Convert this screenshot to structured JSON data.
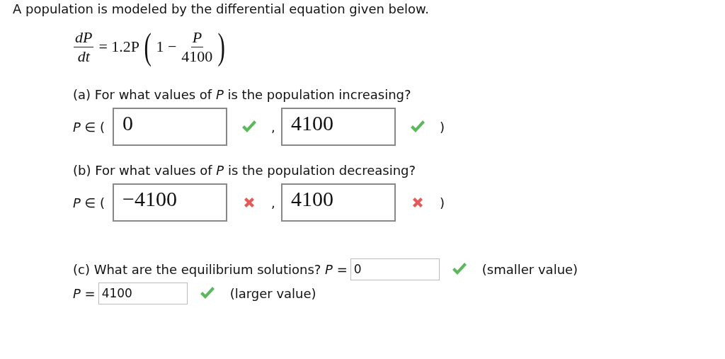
{
  "intro": "A population is modeled by the differential equation given below.",
  "equation": {
    "lhs_numerator": "dP",
    "lhs_denominator": "dt",
    "equals": "= 1.2P",
    "open_paren": "(",
    "one_minus": "1 −",
    "numerator": "P",
    "denominator": "4100",
    "close_paren": ")"
  },
  "parts": [
    {
      "prompt": "(a) For what values of *P* is the population increasing?",
      "prefix": "*P* ∈ (",
      "separator": ",",
      "suffix": ")",
      "fields": [
        {
          "value": "0",
          "correct": true
        },
        {
          "value": "4100",
          "correct": true
        }
      ]
    },
    {
      "prompt": "(b) For what values of *P* is the population decreasing?",
      "prefix": "*P* ∈ (",
      "separator": ",",
      "suffix": ")",
      "fields": [
        {
          "value": "−4100",
          "correct": false
        },
        {
          "value": "4100",
          "correct": false
        }
      ]
    }
  ],
  "equilibrium": {
    "lines": [
      {
        "label": "(c) What are the equilibrium solutions? *P* =",
        "field": {
          "value": "0",
          "correct": true
        },
        "note": "(smaller value)"
      },
      {
        "label": "*P* =",
        "field": {
          "value": "4100",
          "correct": true
        },
        "note": "(larger value)"
      }
    ]
  }
}
